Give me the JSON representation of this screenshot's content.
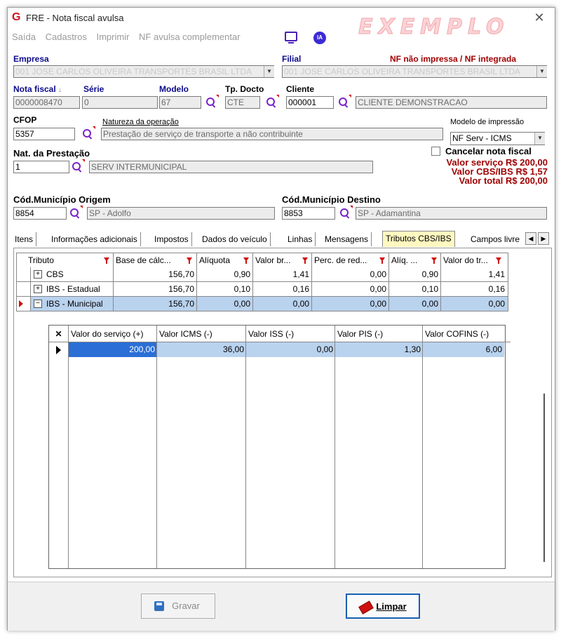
{
  "window": {
    "title": "FRE - Nota fiscal avulsa",
    "logo_letter": "G",
    "close_glyph": "✕",
    "watermark": "EXEMPLO"
  },
  "menu": {
    "items": [
      "Saída",
      "Cadastros",
      "Imprimir",
      "NF avulsa complementar"
    ],
    "ia_label": "IA"
  },
  "labels": {
    "empresa": "Empresa",
    "filial": "Filial",
    "status": "NF não impressa / NF integrada",
    "nota_fiscal": "Nota fiscal",
    "nota_fiscal_sort": "↓",
    "serie": "Série",
    "modelo": "Modelo",
    "tp_docto": "Tp. Docto",
    "cliente": "Cliente",
    "cfop": "CFOP",
    "natureza": "Natureza da operação",
    "modelo_impressao": "Modelo de impressão",
    "cancelar": "Cancelar nota fiscal",
    "nat_prestacao": "Nat. da Prestação",
    "cod_origem": "Cód.Município Origem",
    "cod_destino": "Cód.Município Destino"
  },
  "fields": {
    "empresa": "001 JOSE CARLOS OLIVEIRA TRANSPORTES BRASIL LTDA",
    "filial": "001 JOSE CARLOS OLIVEIRA TRANSPORTES BRASIL LTDA",
    "nota_fiscal": "0000008470",
    "serie": "0",
    "modelo": "67",
    "tp_docto": "CTE",
    "cliente_codigo": "000001",
    "cliente_nome": "CLIENTE DEMONSTRACAO",
    "cfop": "5357",
    "natureza": "Prestação de serviço de transporte a não contribuinte",
    "modelo_impressao": "NF Serv - ICMS",
    "nat_prestacao_codigo": "1",
    "nat_prestacao_nome": "SERV INTERMUNICIPAL",
    "origem_codigo": "8854",
    "origem_nome": "SP - Adolfo",
    "destino_codigo": "8853",
    "destino_nome": "SP - Adamantina",
    "cancelar_checked": false
  },
  "totals": {
    "servico": "Valor serviço R$ 200,00",
    "cbs_ibs": "Valor CBS/IBS R$ 1,57",
    "total": "Valor total R$ 200,00"
  },
  "tabs": [
    "Itens",
    "Informações adicionais",
    "Impostos",
    "Dados do veículo",
    "Linhas",
    "Mensagens",
    "Tributos CBS/IBS",
    "Campos livre"
  ],
  "active_tab": "Tributos CBS/IBS",
  "tributos_grid": {
    "headers": [
      "Tributo",
      "Base de cálc...",
      "Alíquota",
      "Valor br...",
      "Perc. de red...",
      "Alíq. ...",
      "Valor do tr..."
    ],
    "rows": [
      {
        "expander": "+",
        "cells": [
          "CBS",
          "156,70",
          "0,90",
          "1,41",
          "0,00",
          "0,90",
          "1,41"
        ]
      },
      {
        "expander": "+",
        "cells": [
          "IBS - Estadual",
          "156,70",
          "0,10",
          "0,16",
          "0,00",
          "0,10",
          "0,16"
        ]
      },
      {
        "expander": "−",
        "cells": [
          "IBS - Municipal",
          "156,70",
          "0,00",
          "0,00",
          "0,00",
          "0,00",
          "0,00"
        ]
      }
    ]
  },
  "sub_grid": {
    "corner": "✕",
    "headers": [
      "Valor do serviço (+)",
      "Valor ICMS (-)",
      "Valor ISS (-)",
      "Valor PIS (-)",
      "Valor COFINS (-)"
    ],
    "rows": [
      [
        "200,00",
        "36,00",
        "0,00",
        "1,30",
        "6,00"
      ]
    ]
  },
  "buttons": {
    "gravar": "Gravar",
    "limpar": "Limpar"
  },
  "colors": {
    "accent_red": "#a00000",
    "label_blue": "#0a0a8a",
    "search_icon": "#7a22c7",
    "selected_row": "#b9d2ee",
    "active_tab": "#fff8c0"
  }
}
